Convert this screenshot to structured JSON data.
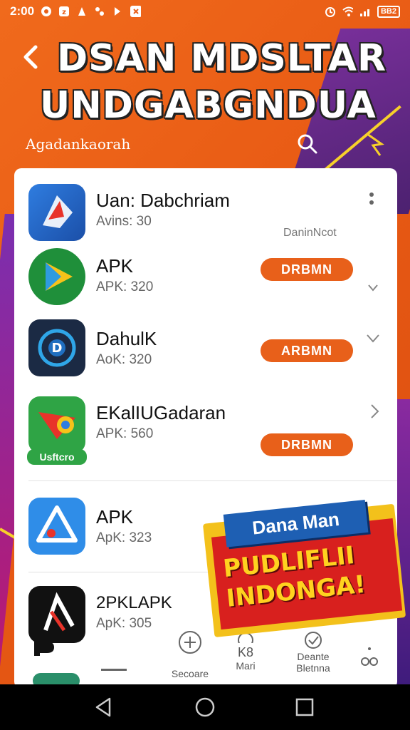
{
  "status_bar": {
    "time": "2:00",
    "battery": "BB2"
  },
  "header": {
    "title_line1": "DSAN MDSLTAR",
    "title_line2": "UNDGABGNDUA",
    "search_label": "Agadankaorah"
  },
  "apps": [
    {
      "name": "Uan: Dabchriam",
      "sub": "Avins: 30",
      "extra": "DaninNcot",
      "button": ""
    },
    {
      "name": "APK",
      "sub": "APK: 320",
      "extra": "",
      "button": "DRBMN"
    },
    {
      "name": "DahulK",
      "sub": "AoK: 320",
      "extra": "",
      "button": "ARBMN"
    },
    {
      "name": "EKalIUGadaran",
      "sub": "APK: 560",
      "extra": "",
      "button": "DRBMN",
      "badge": "Usftcro"
    },
    {
      "name": "APK",
      "sub": "ApK: 323",
      "extra": "",
      "button": ""
    },
    {
      "name": "2PKLAPK",
      "sub": "ApK: 305",
      "extra": "",
      "button": ""
    }
  ],
  "bottom_nav": [
    {
      "icon": "plus-circle-icon",
      "label": "Secoare"
    },
    {
      "icon": "clock-icon",
      "label_top": "K8",
      "label": "Mari"
    },
    {
      "icon": "check-circle-icon",
      "label_top": "Deante",
      "label": "Bletnna"
    }
  ],
  "promo": {
    "tag": "Dana Man",
    "line1": "PUDLIFLII",
    "line2": "INDONGA!"
  },
  "colors": {
    "accent": "#e8601a",
    "promo_blue": "#1e5fb3",
    "promo_red": "#d8201e",
    "promo_yellow": "#f3c11b"
  }
}
